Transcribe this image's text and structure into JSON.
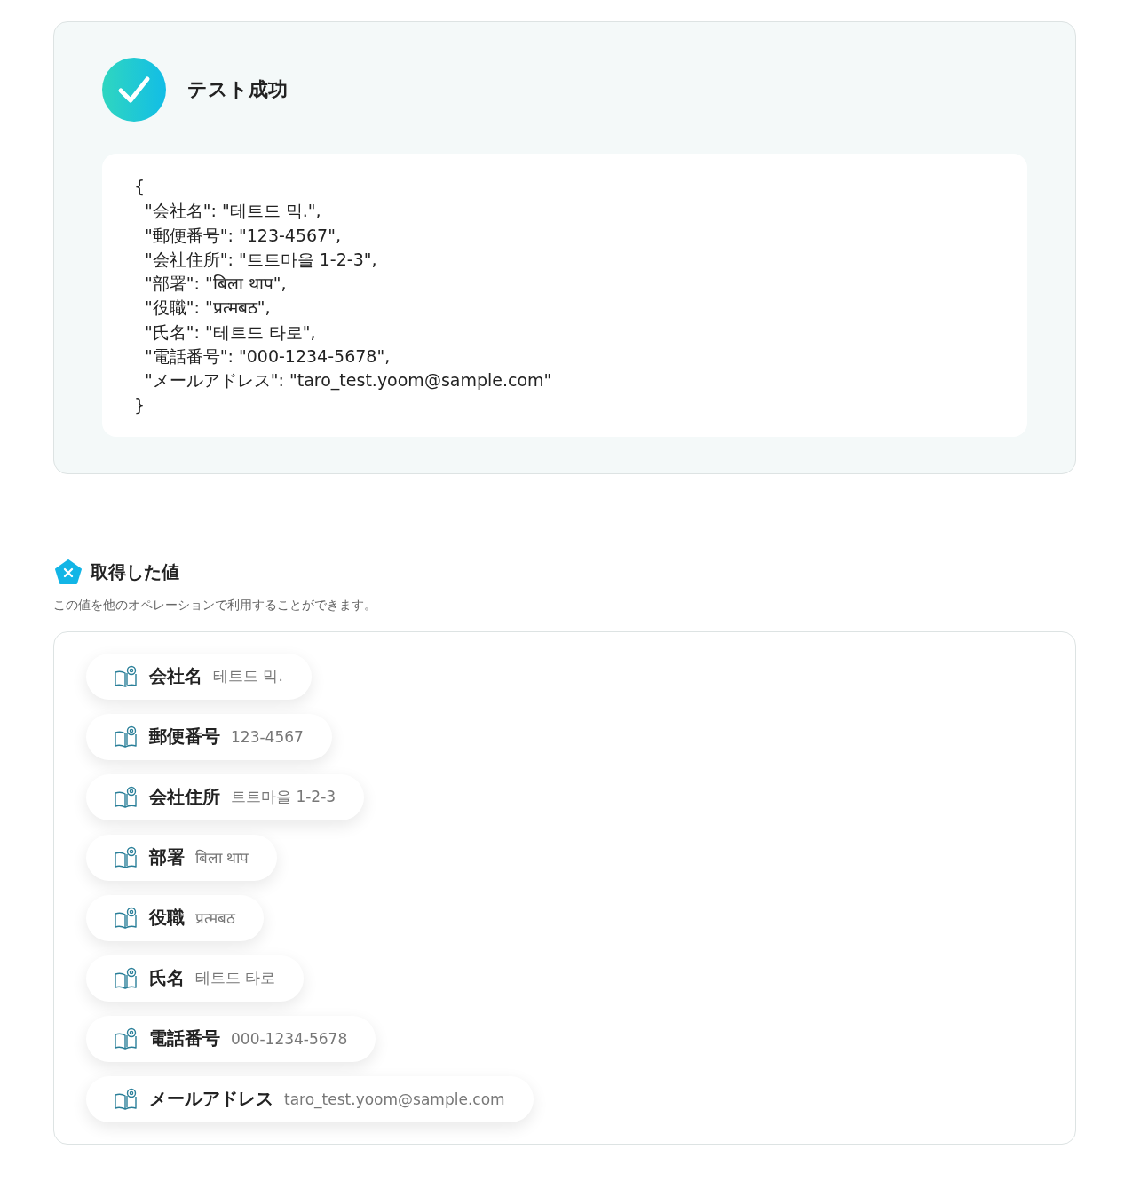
{
  "result": {
    "title": "テスト成功",
    "code_lines": [
      "{",
      "  \"会社名\": \"테트드 믹.\",",
      "  \"郵便番号\": \"123-4567\",",
      "  \"会社住所\": \"트트마을 1-2-3\",",
      "  \"部署\": \"बिला थाप\",",
      "  \"役職\": \"प्रत्मबठ\",",
      "  \"氏名\": \"테트드 타로\",",
      "  \"電話番号\": \"000-1234-5678\",",
      "  \"メールアドレス\": \"taro_test.yoom@sample.com\"",
      "}"
    ]
  },
  "values": {
    "title": "取得した値",
    "description": "この値を他のオペレーションで利用することができます。",
    "items": [
      {
        "label": "会社名",
        "value": "테트드 믹."
      },
      {
        "label": "郵便番号",
        "value": "123-4567"
      },
      {
        "label": "会社住所",
        "value": "트트마을 1-2-3"
      },
      {
        "label": "部署",
        "value": "बिला थाप"
      },
      {
        "label": "役職",
        "value": "प्रत्मबठ"
      },
      {
        "label": "氏名",
        "value": "테트드 타로"
      },
      {
        "label": "電話番号",
        "value": "000-1234-5678"
      },
      {
        "label": "メールアドレス",
        "value": "taro_test.yoom@sample.com"
      }
    ]
  }
}
